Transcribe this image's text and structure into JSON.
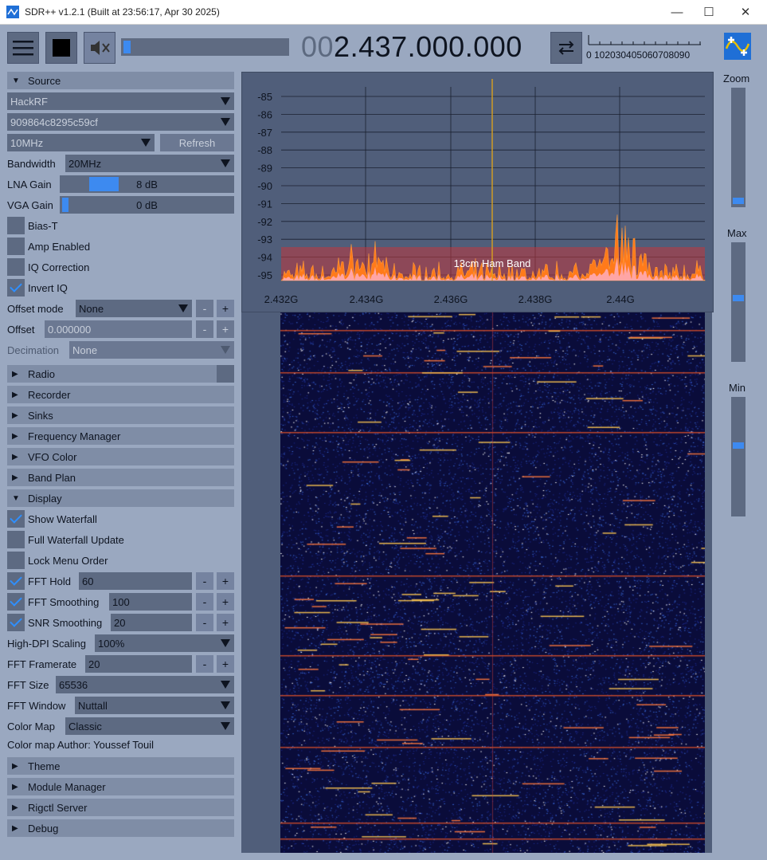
{
  "window": {
    "title": "SDR++ v1.2.1 (Built at 23:56:17, Apr 30 2025)",
    "minimize": "—",
    "maximize": "☐",
    "close": "✕"
  },
  "toolbar": {
    "frequency_lead": "00",
    "frequency_main": "2.437.000.000",
    "snr_scale": "0 102030405060708090",
    "volume_level": 0.05
  },
  "source": {
    "header": "Source",
    "device": "HackRF",
    "serial": "909864c8295c59cf",
    "samplerate": "10MHz",
    "refresh": "Refresh",
    "bandwidth_label": "Bandwidth",
    "bandwidth": "20MHz",
    "lna_label": "LNA Gain",
    "lna_value": "8 dB",
    "vga_label": "VGA Gain",
    "vga_value": "0 dB",
    "bias_t": "Bias-T",
    "amp": "Amp Enabled",
    "iq_corr": "IQ Correction",
    "invert_iq": "Invert IQ",
    "offset_mode_label": "Offset mode",
    "offset_mode": "None",
    "offset_label": "Offset",
    "offset": "0.000000",
    "decimation_label": "Decimation",
    "decimation": "None",
    "minus": "-",
    "plus": "+"
  },
  "menus": {
    "radio": "Radio",
    "recorder": "Recorder",
    "sinks": "Sinks",
    "freq_manager": "Frequency Manager",
    "vfo_color": "VFO Color",
    "band_plan": "Band Plan",
    "display": "Display",
    "theme": "Theme",
    "module_manager": "Module Manager",
    "rigctl": "Rigctl Server",
    "debug": "Debug"
  },
  "display": {
    "show_waterfall": "Show Waterfall",
    "full_wf_update": "Full Waterfall Update",
    "lock_menu": "Lock Menu Order",
    "fft_hold": "FFT Hold",
    "fft_hold_val": "60",
    "fft_smoothing": "FFT Smoothing",
    "fft_smoothing_val": "100",
    "snr_smoothing": "SNR Smoothing",
    "snr_smoothing_val": "20",
    "hidpi_label": "High-DPI Scaling",
    "hidpi": "100%",
    "fps_label": "FFT Framerate",
    "fps": "20",
    "fftsize_label": "FFT Size",
    "fftsize": "65536",
    "window_label": "FFT Window",
    "window": "Nuttall",
    "colormap_label": "Color Map",
    "colormap": "Classic",
    "colormap_author": "Color map Author: Youssef Touil"
  },
  "right_sliders": {
    "zoom": "Zoom",
    "max": "Max",
    "min": "Min"
  },
  "fft": {
    "band_label": "13cm Ham Band",
    "y_ticks": [
      "-85",
      "-86",
      "-87",
      "-88",
      "-89",
      "-90",
      "-91",
      "-92",
      "-93",
      "-94",
      "-95"
    ],
    "x_ticks": [
      "2.432G",
      "2.434G",
      "2.436G",
      "2.438G",
      "2.44G"
    ]
  },
  "colors": {
    "accent": "#3d8af0",
    "band": "#c0363c",
    "trace": "#ff7a1a"
  }
}
